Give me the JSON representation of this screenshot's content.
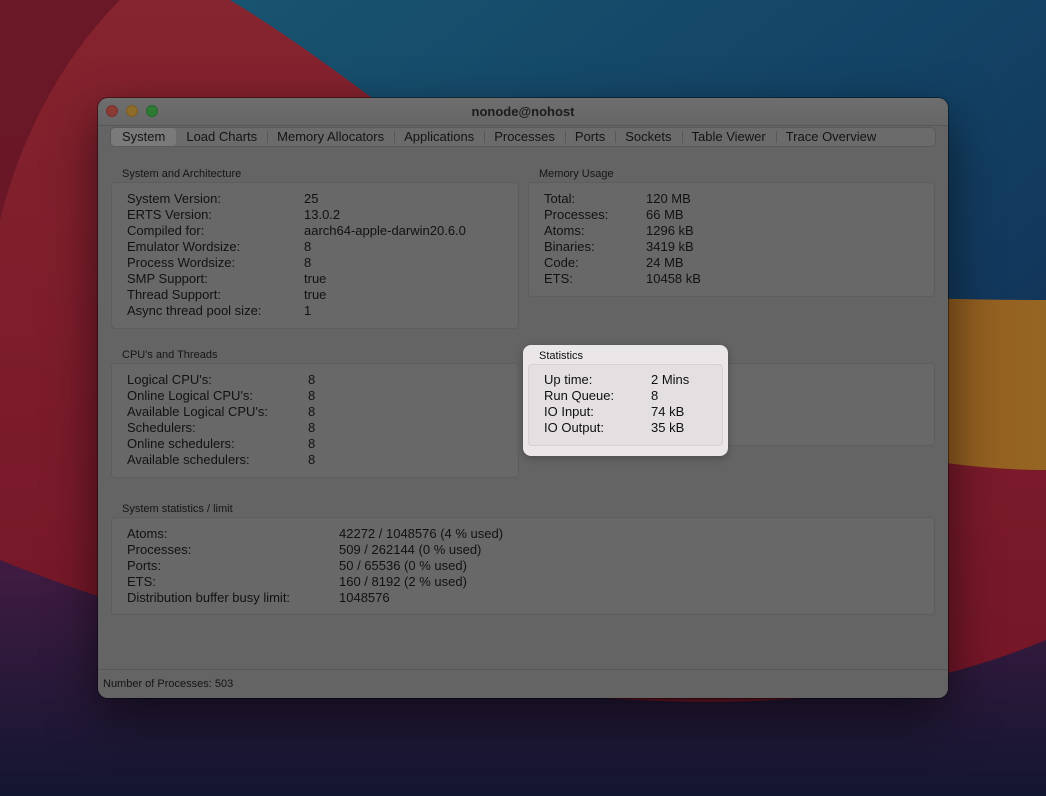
{
  "window": {
    "title": "nonode@nohost"
  },
  "tabs": [
    {
      "label": "System",
      "active": true
    },
    {
      "label": "Load Charts",
      "active": false
    },
    {
      "label": "Memory Allocators",
      "active": false
    },
    {
      "label": "Applications",
      "active": false
    },
    {
      "label": "Processes",
      "active": false
    },
    {
      "label": "Ports",
      "active": false
    },
    {
      "label": "Sockets",
      "active": false
    },
    {
      "label": "Table Viewer",
      "active": false
    },
    {
      "label": "Trace Overview",
      "active": false
    }
  ],
  "system_arch": {
    "title": "System and Architecture",
    "rows": [
      {
        "label": "System Version:",
        "value": "25"
      },
      {
        "label": "ERTS Version:",
        "value": "13.0.2"
      },
      {
        "label": "Compiled for:",
        "value": "aarch64-apple-darwin20.6.0"
      },
      {
        "label": "Emulator Wordsize:",
        "value": "8"
      },
      {
        "label": "Process Wordsize:",
        "value": "8"
      },
      {
        "label": "SMP Support:",
        "value": "true"
      },
      {
        "label": "Thread Support:",
        "value": "true"
      },
      {
        "label": "Async thread pool size:",
        "value": "1"
      }
    ]
  },
  "memory": {
    "title": "Memory Usage",
    "rows": [
      {
        "label": "Total:",
        "value": "120 MB"
      },
      {
        "label": "Processes:",
        "value": "66 MB"
      },
      {
        "label": "Atoms:",
        "value": "1296 kB"
      },
      {
        "label": "Binaries:",
        "value": "3419 kB"
      },
      {
        "label": "Code:",
        "value": "24 MB"
      },
      {
        "label": "ETS:",
        "value": "10458 kB"
      }
    ]
  },
  "cpu": {
    "title": "CPU's and Threads",
    "rows": [
      {
        "label": "Logical CPU's:",
        "value": "8"
      },
      {
        "label": "Online Logical CPU's:",
        "value": "8"
      },
      {
        "label": "Available Logical CPU's:",
        "value": "8"
      },
      {
        "label": "Schedulers:",
        "value": "8"
      },
      {
        "label": "Online schedulers:",
        "value": "8"
      },
      {
        "label": "Available schedulers:",
        "value": "8"
      }
    ]
  },
  "statistics": {
    "title": "Statistics",
    "rows": [
      {
        "label": "Up time:",
        "value": "2 Mins"
      },
      {
        "label": "Run Queue:",
        "value": "8"
      },
      {
        "label": "IO Input:",
        "value": "74 kB"
      },
      {
        "label": "IO Output:",
        "value": "35 kB"
      }
    ]
  },
  "limits": {
    "title": "System statistics / limit",
    "rows": [
      {
        "label": "Atoms:",
        "value": "42272 / 1048576 (4 % used)"
      },
      {
        "label": "Processes:",
        "value": "509 / 262144 (0 % used)"
      },
      {
        "label": "Ports:",
        "value": "50 / 65536 (0 % used)"
      },
      {
        "label": "ETS:",
        "value": "160 / 8192 (2 % used)"
      },
      {
        "label": "Distribution buffer busy limit:",
        "value": "1048576"
      }
    ]
  },
  "status": {
    "text": "Number of Processes: 503"
  }
}
